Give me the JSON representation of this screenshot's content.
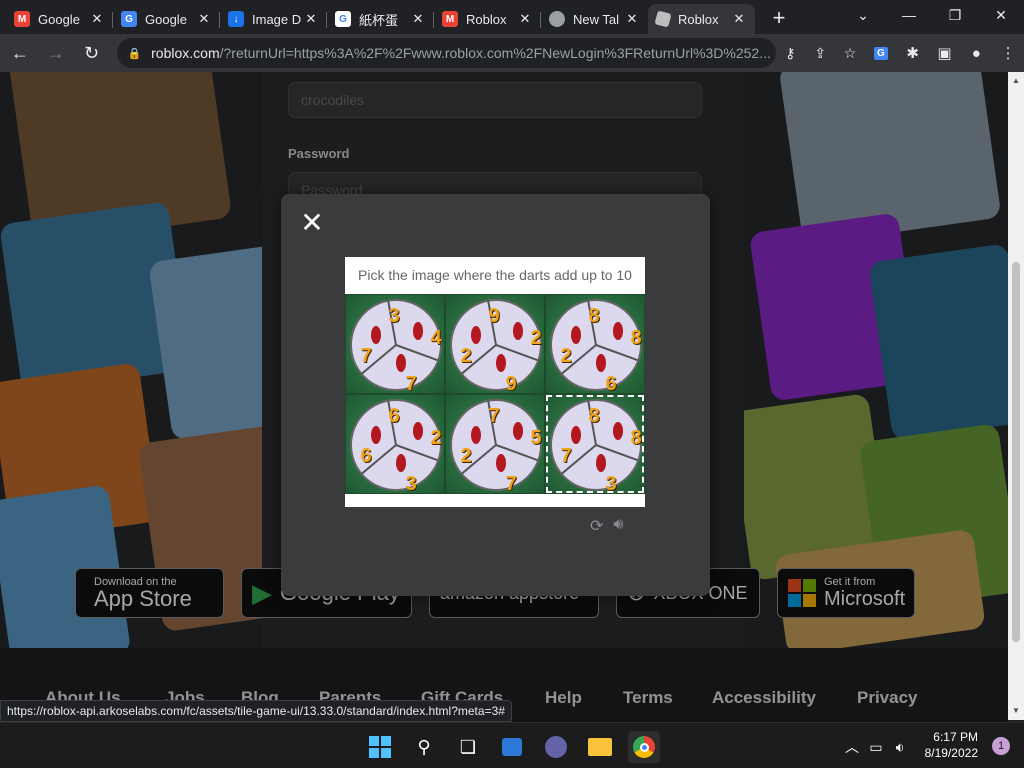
{
  "browser": {
    "tabs": [
      {
        "title": "Google",
        "favicon": "gmail-icon",
        "color": "#ea4335",
        "active": false
      },
      {
        "title": "Google",
        "favicon": "google-translate-icon",
        "color": "#4285f4",
        "active": false
      },
      {
        "title": "Image D",
        "favicon": "download-icon",
        "color": "#1a73e8",
        "active": false
      },
      {
        "title": "紙杯蛋",
        "favicon": "google-icon",
        "color": "#ffffff",
        "active": false
      },
      {
        "title": "Roblox",
        "favicon": "gmail-icon",
        "color": "#ea4335",
        "active": false
      },
      {
        "title": "New Tal",
        "favicon": "chrome-icon",
        "color": "#9aa0a6",
        "active": false
      },
      {
        "title": "Roblox",
        "favicon": "roblox-icon",
        "color": "#bdbdbd",
        "active": true
      }
    ],
    "url_host": "roblox.com",
    "url_rest": "/?returnUrl=https%3A%2F%2Fwww.roblox.com%2FNewLogin%3FReturnUrl%3D%252..."
  },
  "page": {
    "username_value": "crocodiles",
    "password_label": "Password",
    "password_placeholder": "Password",
    "badges": [
      {
        "small": "Download on the",
        "big": "App Store"
      },
      {
        "small": "",
        "big": "Google Play"
      },
      {
        "small": "",
        "big": "amazon appstore"
      },
      {
        "small": "",
        "big": "XBOX ONE"
      },
      {
        "small": "Get it from",
        "big": "Microsoft"
      }
    ],
    "footer_links": [
      "About Us",
      "Jobs",
      "Blog",
      "Parents",
      "Gift Cards",
      "Help",
      "Terms",
      "Accessibility",
      "Privacy"
    ]
  },
  "captcha": {
    "prompt": "Pick the image where the darts add up to 10",
    "tiles": [
      {
        "numbers": [
          "3",
          "4",
          "7",
          "7"
        ]
      },
      {
        "numbers": [
          "9",
          "2",
          "2",
          "9"
        ]
      },
      {
        "numbers": [
          "8",
          "8",
          "2",
          "6"
        ]
      },
      {
        "numbers": [
          "6",
          "2",
          "6",
          "3"
        ]
      },
      {
        "numbers": [
          "7",
          "5",
          "2",
          "7"
        ]
      },
      {
        "numbers": [
          "8",
          "8",
          "7",
          "3"
        ]
      }
    ],
    "selected_tile": 5
  },
  "status_url": "https://roblox-api.arkoselabs.com/fc/assets/tile-game-ui/13.33.0/standard/index.html?meta=3#",
  "taskbar": {
    "time": "6:17 PM",
    "date": "8/19/2022",
    "notifications": "1"
  }
}
